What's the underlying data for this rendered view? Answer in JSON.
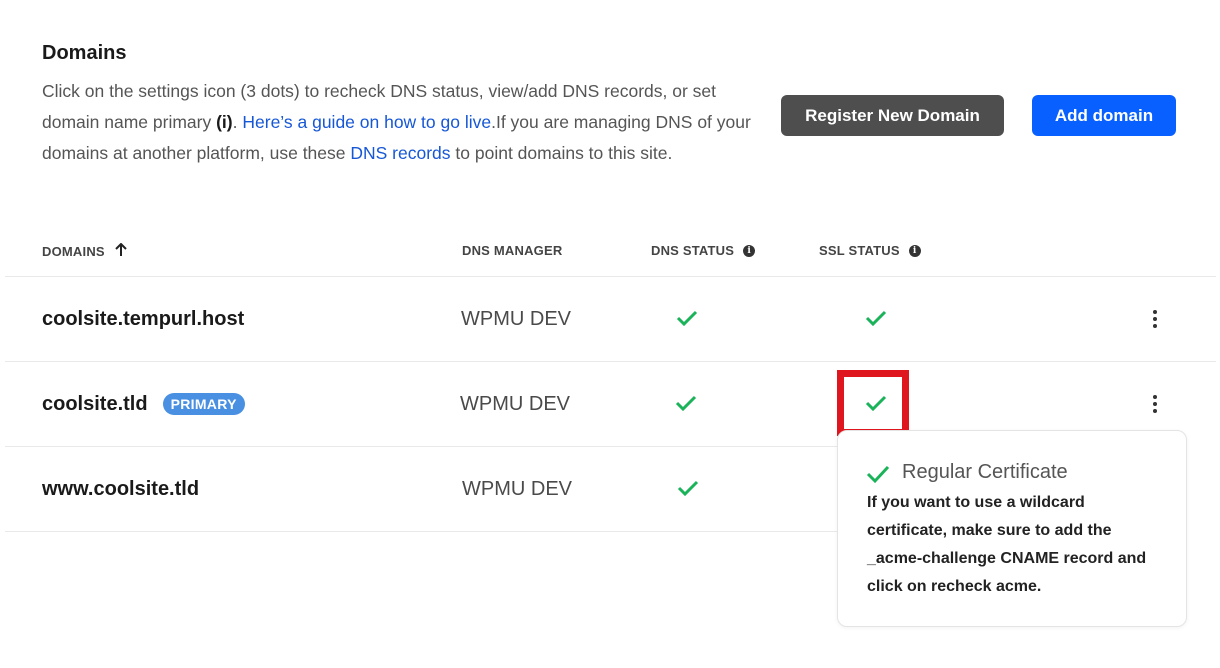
{
  "header": {
    "title": "Domains",
    "desc_part1": "Click on the settings icon (3 dots) to recheck DNS status, view/add DNS records, or set domain name primary ",
    "desc_bold": "(i)",
    "desc_part2": ". ",
    "guide_link": "Here’s a guide on how to go live",
    "desc_part3": ".If you are managing DNS of your domains at another platform, use these ",
    "dns_records_link": "DNS records",
    "desc_part4": " to point domains to this site."
  },
  "buttons": {
    "register": "Register New Domain",
    "add": "Add domain"
  },
  "table": {
    "columns": {
      "domains": "DOMAINS",
      "dns_manager": "DNS MANAGER",
      "dns_status": "DNS STATUS",
      "ssl_status": "SSL STATUS"
    },
    "rows": [
      {
        "domain": "coolsite.tempurl.host",
        "badge": "",
        "dns_manager": "WPMU DEV",
        "dns_status": "ok",
        "ssl_status": "ok"
      },
      {
        "domain": "coolsite.tld",
        "badge": "PRIMARY",
        "dns_manager": "WPMU DEV",
        "dns_status": "ok",
        "ssl_status": "ok"
      },
      {
        "domain": "www.coolsite.tld",
        "badge": "",
        "dns_manager": "WPMU DEV",
        "dns_status": "ok",
        "ssl_status": "ok"
      }
    ]
  },
  "tooltip": {
    "title": "Regular Certificate",
    "body": "If you want to use a wildcard certificate, make sure to add the _acme-challenge CNAME record and click on recheck acme."
  },
  "colors": {
    "accent_blue": "#0760ff",
    "check_green": "#1bb35a",
    "badge_blue": "#4a90e2",
    "highlight_red": "#e0161e",
    "register_gray": "#4e4e4e"
  }
}
